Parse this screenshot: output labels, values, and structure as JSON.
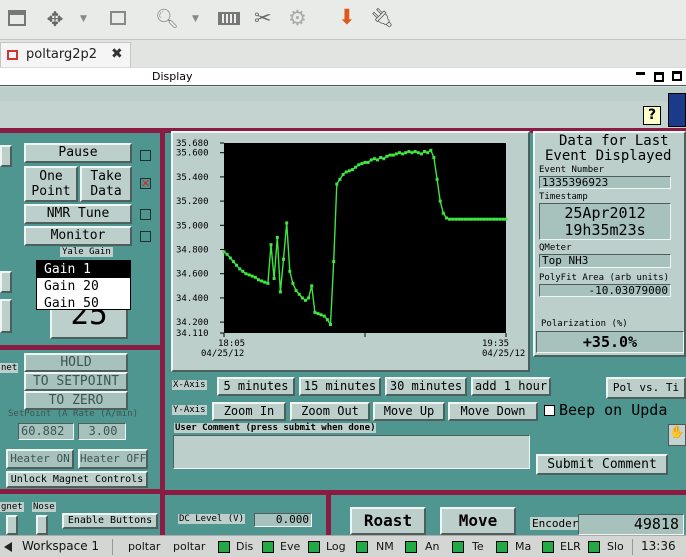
{
  "tab": {
    "title": "poltarg2p2"
  },
  "display": {
    "title": "Display"
  },
  "controls": {
    "pause": "Pause",
    "one_point": [
      "One",
      "Point"
    ],
    "take_data": [
      "Take",
      "Data"
    ],
    "nmr_tune": "NMR Tune",
    "monitor": "Monitor",
    "yale_gain_label": "Yale Gain",
    "gain_options": [
      "Gain 1",
      "Gain 20",
      "Gain 50"
    ],
    "gain_selected": "Gain 1",
    "big_value": "25"
  },
  "chart": {
    "y_ticks": [
      "35.680",
      "35.600",
      "35.400",
      "35.200",
      "35.000",
      "34.800",
      "34.600",
      "34.400",
      "34.200",
      "34.110"
    ],
    "x_tick_left": [
      "18:05",
      "04/25/12"
    ],
    "x_tick_right": [
      "19:35",
      "04/25/12"
    ]
  },
  "chart_data": {
    "type": "line",
    "title": "",
    "xlabel": "",
    "ylabel": "",
    "xlim": [
      "04/25/12 18:05",
      "04/25/12 19:35"
    ],
    "ylim": [
      34.11,
      35.68
    ],
    "x_minutes": [
      0,
      1,
      2,
      3,
      4,
      5,
      6,
      7,
      8,
      9,
      10,
      11,
      12,
      13,
      14,
      15,
      16,
      17,
      18,
      19,
      20,
      21,
      22,
      23,
      24,
      25,
      26,
      27,
      28,
      29,
      30,
      31,
      32,
      33,
      34,
      35,
      36,
      37,
      38,
      39,
      40,
      41,
      42,
      43,
      44,
      45,
      46,
      47,
      48,
      49,
      50,
      51,
      52,
      53,
      54,
      55,
      56,
      57,
      58,
      59,
      60,
      61,
      62,
      63,
      64,
      65,
      66,
      67,
      68,
      69,
      70,
      71,
      72,
      73,
      74,
      75,
      76,
      77,
      78,
      79,
      80,
      81,
      82,
      83,
      84,
      85,
      86,
      87,
      88,
      89,
      90
    ],
    "values": [
      34.78,
      34.76,
      34.73,
      34.7,
      34.67,
      34.64,
      34.62,
      34.6,
      34.59,
      34.58,
      34.57,
      34.55,
      34.54,
      34.53,
      34.52,
      34.84,
      34.56,
      34.9,
      34.45,
      34.72,
      35.02,
      34.62,
      34.52,
      34.46,
      34.43,
      34.4,
      34.38,
      34.4,
      34.5,
      34.28,
      34.27,
      34.26,
      34.25,
      34.22,
      34.18,
      34.7,
      35.34,
      35.38,
      35.42,
      35.44,
      35.45,
      35.46,
      35.48,
      35.5,
      35.51,
      35.52,
      35.52,
      35.54,
      35.55,
      35.54,
      35.56,
      35.55,
      35.57,
      35.58,
      35.58,
      35.59,
      35.6,
      35.59,
      35.6,
      35.61,
      35.6,
      35.61,
      35.6,
      35.59,
      35.61,
      35.6,
      35.62,
      35.56,
      35.38,
      35.2,
      35.1,
      35.06,
      35.05,
      35.05,
      35.05,
      35.05,
      35.05,
      35.05,
      35.05,
      35.05,
      35.05,
      35.05,
      35.05,
      35.05,
      35.05,
      35.05,
      35.05,
      35.05,
      35.05,
      35.05,
      35.05
    ],
    "line_color": "#3fe63f",
    "grid": false
  },
  "info": {
    "title": [
      "Data for Last",
      "Event Displayed"
    ],
    "event_number_label": "Event Number",
    "event_number": "1335396923",
    "timestamp_label": "Timestamp",
    "date": "25Apr2012",
    "time": "19h35m23s",
    "qmeter_label": "QMeter",
    "qmeter": "Top NH3",
    "polyfit_label": "PolyFit Area (arb units)",
    "polyfit": "-10.03079000",
    "polarization_label": "Polarization (%)",
    "polarization": "+35.0%"
  },
  "xaxis": {
    "label": "X-Axis",
    "buttons": [
      "5 minutes",
      "15 minutes",
      "30 minutes",
      "add 1 hour"
    ]
  },
  "yaxis": {
    "label": "Y-Axis",
    "buttons": [
      "Zoom In",
      "Zoom Out",
      "Move Up",
      "Move Down"
    ]
  },
  "pol_vs_time": "Pol vs. Ti",
  "beep": "Beep on Upda",
  "comment": {
    "label": "User Comment (press submit when done)",
    "submit": "Submit Comment"
  },
  "magnet": {
    "side_label": "net",
    "hold": "HOLD",
    "to_setpoint": "TO SETPOINT",
    "to_zero": "TO ZERO",
    "setpoint_label": "SetPoint (A Rate (A/min)",
    "setpoint": "60.882",
    "rate": "3.00",
    "heater_on": "Heater ON",
    "heater_off": "Heater OFF",
    "unlock": "Unlock Magnet Controls"
  },
  "bottom": {
    "magnet_lbl": "gnet",
    "nose_lbl": "Nose",
    "enable": "Enable Buttons",
    "dc_level_label": "DC Level (V)",
    "dc_level": "0.000",
    "roast": "Roast",
    "move": "Move",
    "encoder_label": "Encoder",
    "encoder": "49818"
  },
  "taskbar": {
    "workspace": "Workspace 1",
    "items": [
      "poltar",
      "poltar",
      "Dis",
      "Eve",
      "Log",
      "NM",
      "An",
      "Te",
      "Ma",
      "ELR",
      "Slo"
    ],
    "clock": "13:36"
  }
}
